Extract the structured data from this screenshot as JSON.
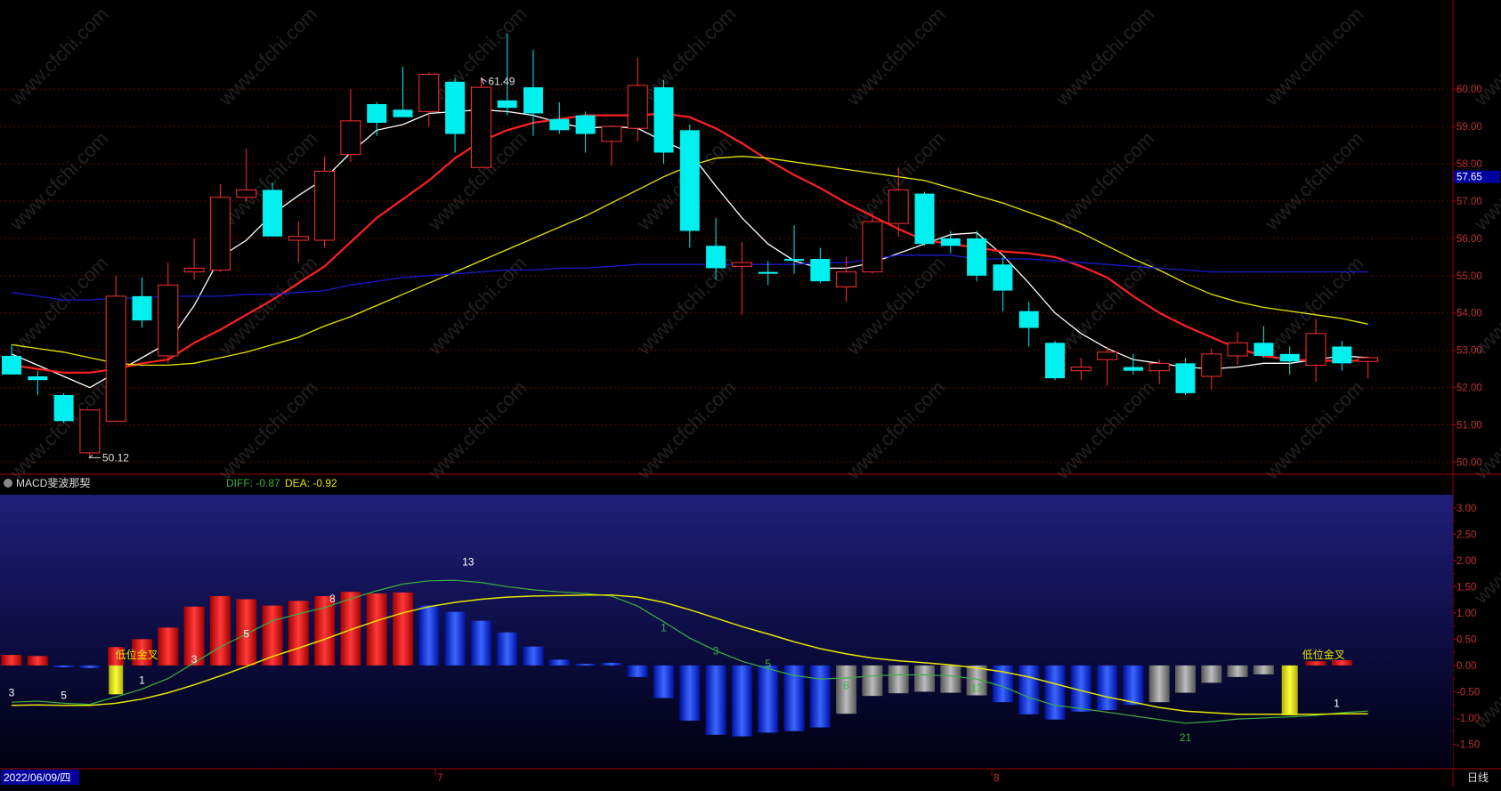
{
  "chart_data": [
    {
      "type": "candlestick",
      "title": "",
      "ylim": [
        49.7,
        62.2
      ],
      "y_ticks": [
        "60.00",
        "59.00",
        "58.00",
        "57.00",
        "56.00",
        "55.00",
        "54.00",
        "53.00",
        "52.00",
        "51.00",
        "50.00"
      ],
      "y_tick_values": [
        60,
        59,
        58,
        57,
        56,
        55,
        54,
        53,
        52,
        51,
        50
      ],
      "current_price_label": "57.65",
      "current_price": 57.65,
      "high_annotation": "61.49",
      "low_annotation": "50.12",
      "high_index": 18,
      "low_index": 3,
      "up_color": "#ff3030",
      "down_color": "#00f0f0",
      "candles": [
        {
          "o": 52.85,
          "h": 53.15,
          "l": 52.35,
          "c": 52.35
        },
        {
          "o": 52.3,
          "h": 52.45,
          "l": 51.8,
          "c": 52.2
        },
        {
          "o": 51.8,
          "h": 51.85,
          "l": 51.05,
          "c": 51.1
        },
        {
          "o": 50.25,
          "h": 51.4,
          "l": 50.12,
          "c": 51.4
        },
        {
          "o": 51.1,
          "h": 55.0,
          "l": 51.1,
          "c": 54.45
        },
        {
          "o": 54.45,
          "h": 54.95,
          "l": 53.6,
          "c": 53.8
        },
        {
          "o": 52.85,
          "h": 55.35,
          "l": 52.65,
          "c": 54.75
        },
        {
          "o": 55.1,
          "h": 56.0,
          "l": 54.9,
          "c": 55.2
        },
        {
          "o": 55.15,
          "h": 57.45,
          "l": 55.1,
          "c": 57.1
        },
        {
          "o": 57.1,
          "h": 58.4,
          "l": 57.0,
          "c": 57.3
        },
        {
          "o": 57.3,
          "h": 57.5,
          "l": 56.05,
          "c": 56.05
        },
        {
          "o": 55.95,
          "h": 56.45,
          "l": 55.35,
          "c": 56.05
        },
        {
          "o": 55.95,
          "h": 58.2,
          "l": 55.75,
          "c": 57.8
        },
        {
          "o": 58.25,
          "h": 60.0,
          "l": 58.05,
          "c": 59.15
        },
        {
          "o": 59.6,
          "h": 59.65,
          "l": 58.75,
          "c": 59.1
        },
        {
          "o": 59.45,
          "h": 60.6,
          "l": 59.25,
          "c": 59.25
        },
        {
          "o": 59.4,
          "h": 60.45,
          "l": 59.0,
          "c": 60.4
        },
        {
          "o": 60.2,
          "h": 60.3,
          "l": 58.3,
          "c": 58.8
        },
        {
          "o": 57.9,
          "h": 60.3,
          "l": 57.9,
          "c": 60.05
        },
        {
          "o": 59.7,
          "h": 61.49,
          "l": 59.3,
          "c": 59.5
        },
        {
          "o": 60.05,
          "h": 61.05,
          "l": 58.75,
          "c": 59.35
        },
        {
          "o": 59.2,
          "h": 59.65,
          "l": 58.8,
          "c": 58.9
        },
        {
          "o": 59.3,
          "h": 59.4,
          "l": 58.3,
          "c": 58.8
        },
        {
          "o": 58.6,
          "h": 58.95,
          "l": 57.95,
          "c": 59.0
        },
        {
          "o": 58.95,
          "h": 60.85,
          "l": 58.6,
          "c": 60.1
        },
        {
          "o": 60.05,
          "h": 60.25,
          "l": 58.0,
          "c": 58.3
        },
        {
          "o": 58.9,
          "h": 59.05,
          "l": 55.75,
          "c": 56.2
        },
        {
          "o": 55.8,
          "h": 56.55,
          "l": 54.9,
          "c": 55.2
        },
        {
          "o": 55.25,
          "h": 55.9,
          "l": 53.95,
          "c": 55.35
        },
        {
          "o": 55.1,
          "h": 55.4,
          "l": 54.75,
          "c": 55.05
        },
        {
          "o": 55.45,
          "h": 56.35,
          "l": 55.05,
          "c": 55.4
        },
        {
          "o": 55.45,
          "h": 55.75,
          "l": 54.8,
          "c": 54.85
        },
        {
          "o": 54.7,
          "h": 55.5,
          "l": 54.3,
          "c": 55.1
        },
        {
          "o": 55.1,
          "h": 56.7,
          "l": 55.05,
          "c": 56.45
        },
        {
          "o": 56.4,
          "h": 57.9,
          "l": 56.05,
          "c": 57.3
        },
        {
          "o": 57.2,
          "h": 57.25,
          "l": 55.8,
          "c": 55.85
        },
        {
          "o": 56.0,
          "h": 56.2,
          "l": 55.6,
          "c": 55.8
        },
        {
          "o": 56.0,
          "h": 56.2,
          "l": 54.85,
          "c": 55.0
        },
        {
          "o": 55.3,
          "h": 55.5,
          "l": 54.05,
          "c": 54.6
        },
        {
          "o": 54.05,
          "h": 54.3,
          "l": 53.1,
          "c": 53.6
        },
        {
          "o": 53.2,
          "h": 53.25,
          "l": 52.2,
          "c": 52.25
        },
        {
          "o": 52.45,
          "h": 52.8,
          "l": 52.2,
          "c": 52.55
        },
        {
          "o": 52.75,
          "h": 53.1,
          "l": 52.05,
          "c": 52.95
        },
        {
          "o": 52.55,
          "h": 52.9,
          "l": 52.35,
          "c": 52.45
        },
        {
          "o": 52.45,
          "h": 52.75,
          "l": 52.1,
          "c": 52.65
        },
        {
          "o": 52.65,
          "h": 52.8,
          "l": 51.8,
          "c": 51.85
        },
        {
          "o": 52.3,
          "h": 53.05,
          "l": 51.95,
          "c": 52.9
        },
        {
          "o": 52.85,
          "h": 53.5,
          "l": 52.6,
          "c": 53.2
        },
        {
          "o": 53.2,
          "h": 53.65,
          "l": 52.8,
          "c": 52.85
        },
        {
          "o": 52.9,
          "h": 53.1,
          "l": 52.35,
          "c": 52.7
        },
        {
          "o": 52.6,
          "h": 53.85,
          "l": 52.15,
          "c": 53.45
        },
        {
          "o": 53.1,
          "h": 53.25,
          "l": 52.45,
          "c": 52.65
        },
        {
          "o": 52.7,
          "h": 52.85,
          "l": 52.25,
          "c": 52.8
        }
      ],
      "series": [
        {
          "color": "#ffffff",
          "values": [
            52.9,
            52.6,
            52.3,
            52.0,
            52.4,
            52.8,
            53.2,
            54.2,
            55.5,
            55.95,
            56.65,
            57.15,
            57.6,
            58.3,
            58.9,
            59.05,
            59.35,
            59.4,
            59.45,
            59.4,
            59.3,
            59.1,
            58.95,
            59.0,
            58.95,
            58.6,
            58.3,
            57.4,
            56.55,
            55.85,
            55.4,
            55.2,
            55.2,
            55.35,
            55.6,
            55.85,
            56.1,
            56.15,
            55.55,
            54.8,
            54.0,
            53.45,
            53.05,
            52.75,
            52.65,
            52.55,
            52.5,
            52.55,
            52.65,
            52.65,
            52.75,
            52.85,
            52.8
          ]
        },
        {
          "color": "#ff2020",
          "values": [
            52.6,
            52.5,
            52.4,
            52.4,
            52.5,
            52.65,
            52.75,
            53.2,
            53.55,
            53.95,
            54.35,
            54.8,
            55.25,
            55.9,
            56.55,
            57.05,
            57.55,
            58.15,
            58.6,
            58.9,
            59.1,
            59.2,
            59.3,
            59.3,
            59.3,
            59.35,
            59.25,
            58.95,
            58.55,
            58.1,
            57.7,
            57.35,
            56.95,
            56.6,
            56.25,
            55.95,
            55.85,
            55.75,
            55.65,
            55.6,
            55.5,
            55.25,
            54.95,
            54.45,
            54.0,
            53.65,
            53.35,
            53.05,
            52.85,
            52.75,
            52.72,
            52.72,
            52.72
          ]
        },
        {
          "color": "#e6e600",
          "values": [
            53.15,
            53.05,
            52.95,
            52.8,
            52.65,
            52.6,
            52.6,
            52.65,
            52.8,
            52.95,
            53.15,
            53.35,
            53.65,
            53.9,
            54.2,
            54.5,
            54.8,
            55.1,
            55.4,
            55.7,
            56.0,
            56.3,
            56.6,
            56.95,
            57.3,
            57.65,
            57.95,
            58.15,
            58.2,
            58.15,
            58.05,
            57.95,
            57.85,
            57.75,
            57.65,
            57.55,
            57.35,
            57.15,
            56.95,
            56.7,
            56.45,
            56.15,
            55.8,
            55.45,
            55.15,
            54.8,
            54.5,
            54.3,
            54.15,
            54.05,
            53.95,
            53.85,
            53.7
          ]
        },
        {
          "color": "#1a1acc",
          "values": [
            54.55,
            54.45,
            54.35,
            54.35,
            54.4,
            54.4,
            54.45,
            54.45,
            54.45,
            54.5,
            54.5,
            54.55,
            54.6,
            54.75,
            54.85,
            54.95,
            55.0,
            55.05,
            55.1,
            55.15,
            55.15,
            55.2,
            55.2,
            55.25,
            55.3,
            55.3,
            55.3,
            55.3,
            55.3,
            55.3,
            55.3,
            55.35,
            55.35,
            55.45,
            55.55,
            55.55,
            55.55,
            55.45,
            55.45,
            55.45,
            55.4,
            55.35,
            55.3,
            55.25,
            55.2,
            55.15,
            55.1,
            55.1,
            55.1,
            55.1,
            55.1,
            55.1,
            55.1
          ]
        }
      ]
    },
    {
      "type": "bar",
      "title": "MACD斐波那契",
      "indicator_label": "MACD斐波那契",
      "diff_label": "DIFF:",
      "diff_value": "-0.87",
      "dea_label": "DEA:",
      "dea_value": "-0.92",
      "ylim": [
        -1.95,
        3.25
      ],
      "y_ticks": [
        "3.00",
        "2.50",
        "2.00",
        "1.50",
        "1.00",
        "0.50",
        "0.00",
        "-0.50",
        "-1.00",
        "-1.50"
      ],
      "y_tick_values": [
        3.0,
        2.5,
        2.0,
        1.5,
        1.0,
        0.5,
        0.0,
        -0.5,
        -1.0,
        -1.5
      ],
      "x_labels": [
        "2022/06/09/四",
        "7",
        "8",
        "日线"
      ],
      "histogram": [
        0.2,
        0.18,
        0.0,
        -0.05,
        0.35,
        0.5,
        0.72,
        1.12,
        1.32,
        1.26,
        1.14,
        1.23,
        1.32,
        1.4,
        1.37,
        1.39,
        1.14,
        1.02,
        0.85,
        0.63,
        0.36,
        0.11,
        0.03,
        0.05,
        -0.22,
        -0.62,
        -1.05,
        -1.32,
        -1.35,
        -1.28,
        -1.25,
        -1.18,
        -0.92,
        -0.58,
        -0.53,
        -0.5,
        -0.52,
        -0.57,
        -0.7,
        -0.93,
        -1.03,
        -0.88,
        -0.85,
        -0.75,
        -0.7,
        -0.52,
        -0.33,
        -0.22,
        -0.17,
        -0.95,
        0.08,
        0.1
      ],
      "histogram_colors": [
        "#e01010",
        "#e01010",
        "#1010e0",
        "#1010e0",
        "#e01010",
        "#e01010",
        "#e01010",
        "#e01010",
        "#e01010",
        "#e01010",
        "#e01010",
        "#e01010",
        "#e01010",
        "#e01010",
        "#e01010",
        "#e01010",
        "#1e3cff",
        "#1e3cff",
        "#1e3cff",
        "#1e3cff",
        "#1e3cff",
        "#1e3cff",
        "#1e3cff",
        "#1e3cff",
        "#1e3cff",
        "#1e3cff",
        "#1e3cff",
        "#1e3cff",
        "#1e3cff",
        "#1e3cff",
        "#1e3cff",
        "#1e3cff",
        "#888888",
        "#888888",
        "#888888",
        "#888888",
        "#888888",
        "#888888",
        "#1e3cff",
        "#1e3cff",
        "#1e3cff",
        "#1e3cff",
        "#1e3cff",
        "#1e3cff",
        "#888888",
        "#888888",
        "#888888",
        "#888888",
        "#888888",
        "#e6e600",
        "#e01010",
        "#e01010"
      ],
      "yellow_bar_index": 4,
      "diff_series": [
        -0.7,
        -0.68,
        -0.72,
        -0.74,
        -0.6,
        -0.45,
        -0.25,
        0.05,
        0.35,
        0.6,
        0.85,
        0.98,
        1.1,
        1.27,
        1.42,
        1.55,
        1.61,
        1.62,
        1.58,
        1.5,
        1.44,
        1.4,
        1.37,
        1.32,
        1.13,
        0.83,
        0.52,
        0.28,
        0.08,
        -0.06,
        -0.19,
        -0.26,
        -0.24,
        -0.2,
        -0.18,
        -0.18,
        -0.2,
        -0.26,
        -0.4,
        -0.61,
        -0.76,
        -0.82,
        -0.89,
        -0.96,
        -1.03,
        -1.1,
        -1.07,
        -1.02,
        -1.0,
        -0.98,
        -0.95,
        -0.9,
        -0.87
      ],
      "dea_series": [
        -0.76,
        -0.75,
        -0.76,
        -0.76,
        -0.72,
        -0.64,
        -0.52,
        -0.37,
        -0.2,
        -0.02,
        0.17,
        0.33,
        0.5,
        0.68,
        0.85,
        1.0,
        1.12,
        1.2,
        1.26,
        1.3,
        1.32,
        1.33,
        1.34,
        1.34,
        1.3,
        1.2,
        1.06,
        0.9,
        0.74,
        0.6,
        0.45,
        0.32,
        0.22,
        0.14,
        0.09,
        0.05,
        0.01,
        -0.05,
        -0.12,
        -0.22,
        -0.35,
        -0.48,
        -0.6,
        -0.7,
        -0.8,
        -0.87,
        -0.9,
        -0.93,
        -0.93,
        -0.93,
        -0.93,
        -0.92,
        -0.92
      ],
      "annotations": [
        {
          "text": "3",
          "i": 0,
          "y": -0.52,
          "color": "#ffffff"
        },
        {
          "text": "5",
          "i": 2,
          "y": -0.57,
          "color": "#ffffff"
        },
        {
          "text": "1",
          "i": 5,
          "y": -0.28,
          "color": "#ffffff"
        },
        {
          "text": "低位金叉",
          "i": 4.8,
          "y": 0.2,
          "color": "#e6e600"
        },
        {
          "text": "3",
          "i": 7,
          "y": 0.12,
          "color": "#ffffff"
        },
        {
          "text": "5",
          "i": 9,
          "y": 0.6,
          "color": "#ffffff"
        },
        {
          "text": "8",
          "i": 12.3,
          "y": 1.27,
          "color": "#ffffff"
        },
        {
          "text": "13",
          "i": 17.5,
          "y": 1.97,
          "color": "#ffffff"
        },
        {
          "text": "1",
          "i": 25,
          "y": 0.72,
          "color": "#3cb043"
        },
        {
          "text": "3",
          "i": 27,
          "y": 0.28,
          "color": "#3cb043"
        },
        {
          "text": "5",
          "i": 29,
          "y": 0.03,
          "color": "#3cb043"
        },
        {
          "text": "8",
          "i": 32,
          "y": -0.38,
          "color": "#3cb043"
        },
        {
          "text": "13",
          "i": 37,
          "y": -0.43,
          "color": "#3cb043"
        },
        {
          "text": "21",
          "i": 45,
          "y": -1.37,
          "color": "#3cb043"
        },
        {
          "text": "低位金叉",
          "i": 50.3,
          "y": 0.2,
          "color": "#e6e600"
        },
        {
          "text": "1",
          "i": 50.8,
          "y": -0.72,
          "color": "#ffffff"
        }
      ]
    }
  ],
  "watermark_text": "www.cfchi.com"
}
